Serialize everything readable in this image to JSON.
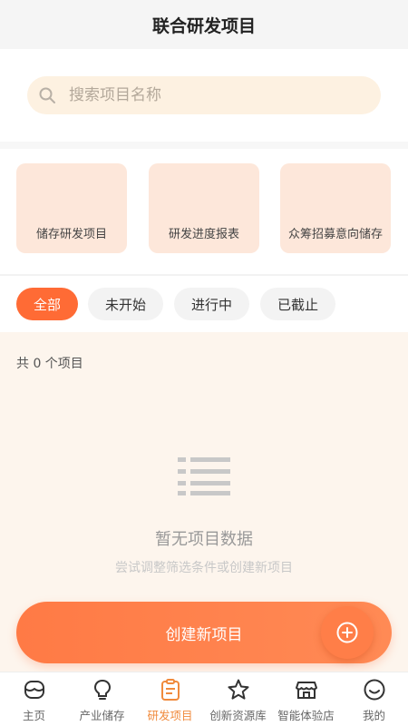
{
  "header": {
    "title": "联合研发项目"
  },
  "search": {
    "placeholder": "搜索项目名称"
  },
  "cards": [
    {
      "label": "储存研发项目"
    },
    {
      "label": "研发进度报表"
    },
    {
      "label": "众筹招募意向储存"
    }
  ],
  "filters": {
    "selected": "全部",
    "items": [
      {
        "label": "全部"
      },
      {
        "label": "未开始"
      },
      {
        "label": "进行中"
      },
      {
        "label": "已截止"
      }
    ]
  },
  "project_count": "共 0 个项目",
  "empty_state": {
    "icon": "list-icon",
    "title": "暂无项目数据",
    "subtitle": "尝试调整筛选条件或创建新项目"
  },
  "create_button": {
    "label": "创建新项目",
    "icon": "plus-circle-icon"
  },
  "tabbar": {
    "selected": "研发项目",
    "items": [
      {
        "label": "主页",
        "icon": "home-icon"
      },
      {
        "label": "产业储存",
        "icon": "lightbulb-icon"
      },
      {
        "label": "研发项目",
        "icon": "clipboard-icon"
      },
      {
        "label": "创新资源库",
        "icon": "star-icon"
      },
      {
        "label": "智能体验店",
        "icon": "store-icon"
      },
      {
        "label": "我的",
        "icon": "smile-icon"
      }
    ]
  },
  "colors": {
    "accent": "#ff6b35",
    "card_bg": "#fde7da",
    "search_bg": "#fdf1e1",
    "content_bg": "#fdf5ed",
    "active_tab_text": "#f08a3c"
  }
}
